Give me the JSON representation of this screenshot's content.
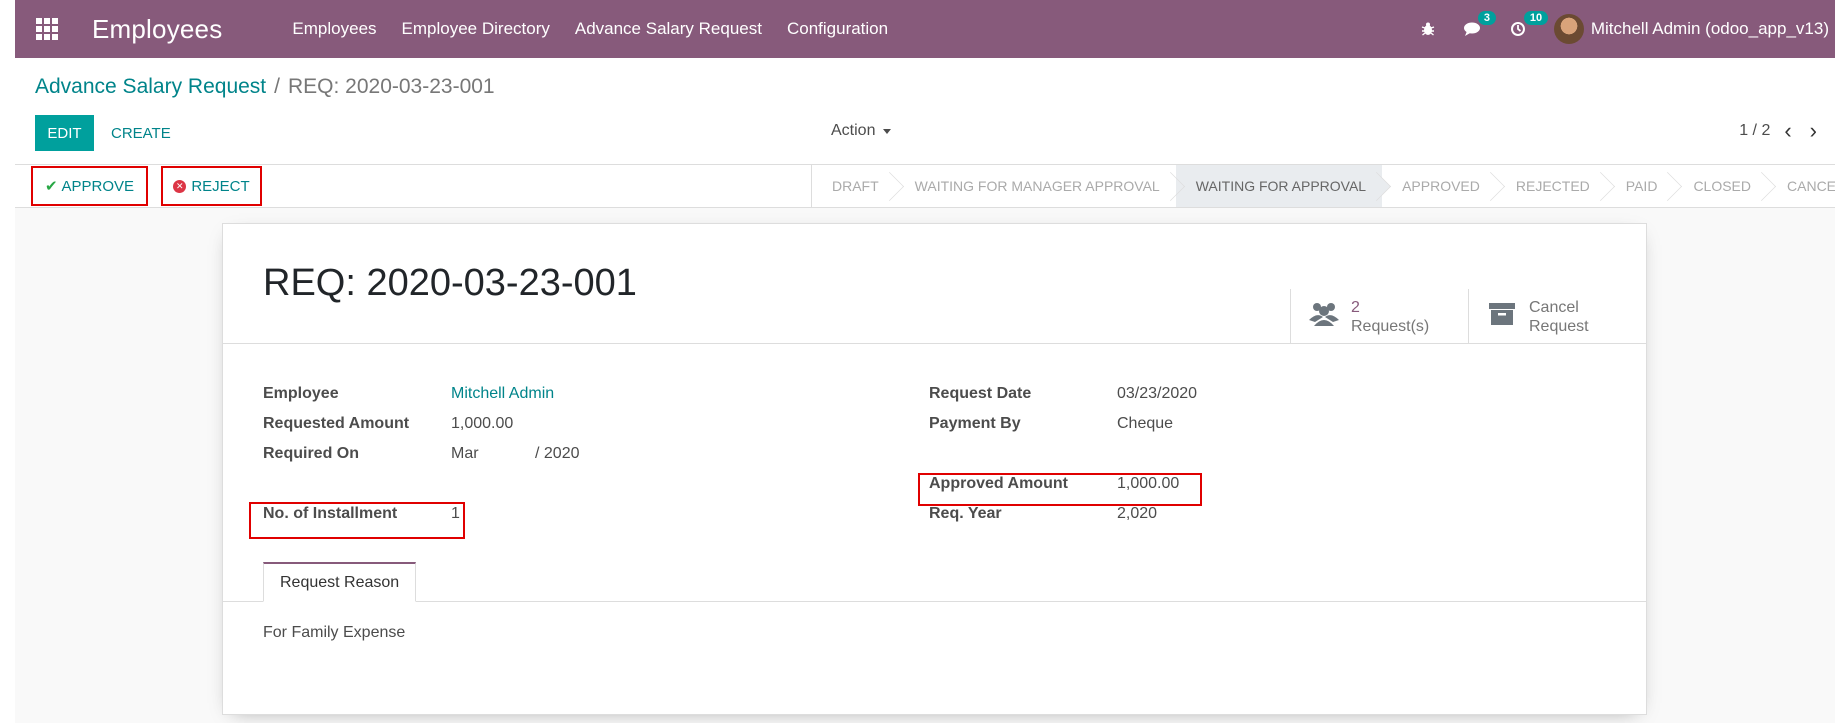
{
  "navbar": {
    "app_name": "Employees",
    "menu": [
      "Employees",
      "Employee Directory",
      "Advance Salary Request",
      "Configuration"
    ],
    "messages_count": "3",
    "activities_count": "10",
    "user": "Mitchell Admin (odoo_app_v13)"
  },
  "breadcrumb": {
    "parent": "Advance Salary Request",
    "current": "REQ: 2020-03-23-001"
  },
  "control": {
    "edit_label": "EDIT",
    "create_label": "CREATE",
    "action_label": "Action",
    "pager": "1 / 2"
  },
  "header_buttons": {
    "approve_label": "APPROVE",
    "reject_label": "REJECT"
  },
  "stages": [
    "DRAFT",
    "WAITING FOR MANAGER APPROVAL",
    "WAITING FOR APPROVAL",
    "APPROVED",
    "REJECTED",
    "PAID",
    "CLOSED",
    "CANCELLED"
  ],
  "active_stage": "WAITING FOR APPROVAL",
  "smart_buttons": {
    "requests_value": "2",
    "requests_label": "Request(s)",
    "cancel_line1": "Cancel",
    "cancel_line2": "Request"
  },
  "form": {
    "title": "REQ: 2020-03-23-001",
    "employee_label": "Employee",
    "employee_value": "Mitchell Admin",
    "requested_amount_label": "Requested Amount",
    "requested_amount_value": "1,000.00",
    "required_on_label": "Required On",
    "required_on_month": "Mar",
    "required_on_year": "/ 2020",
    "installment_label": "No. of Installment",
    "installment_value": "1",
    "request_date_label": "Request Date",
    "request_date_value": "03/23/2020",
    "payment_by_label": "Payment By",
    "payment_by_value": "Cheque",
    "approved_amount_label": "Approved Amount",
    "approved_amount_value": "1,000.00",
    "req_year_label": "Req. Year",
    "req_year_value": "2,020"
  },
  "tab": {
    "label": "Request Reason",
    "content": "For Family Expense"
  },
  "colors": {
    "brand": "#875a7b",
    "accent": "#00a09d",
    "link": "#00848a",
    "highlight": "#e00000"
  }
}
